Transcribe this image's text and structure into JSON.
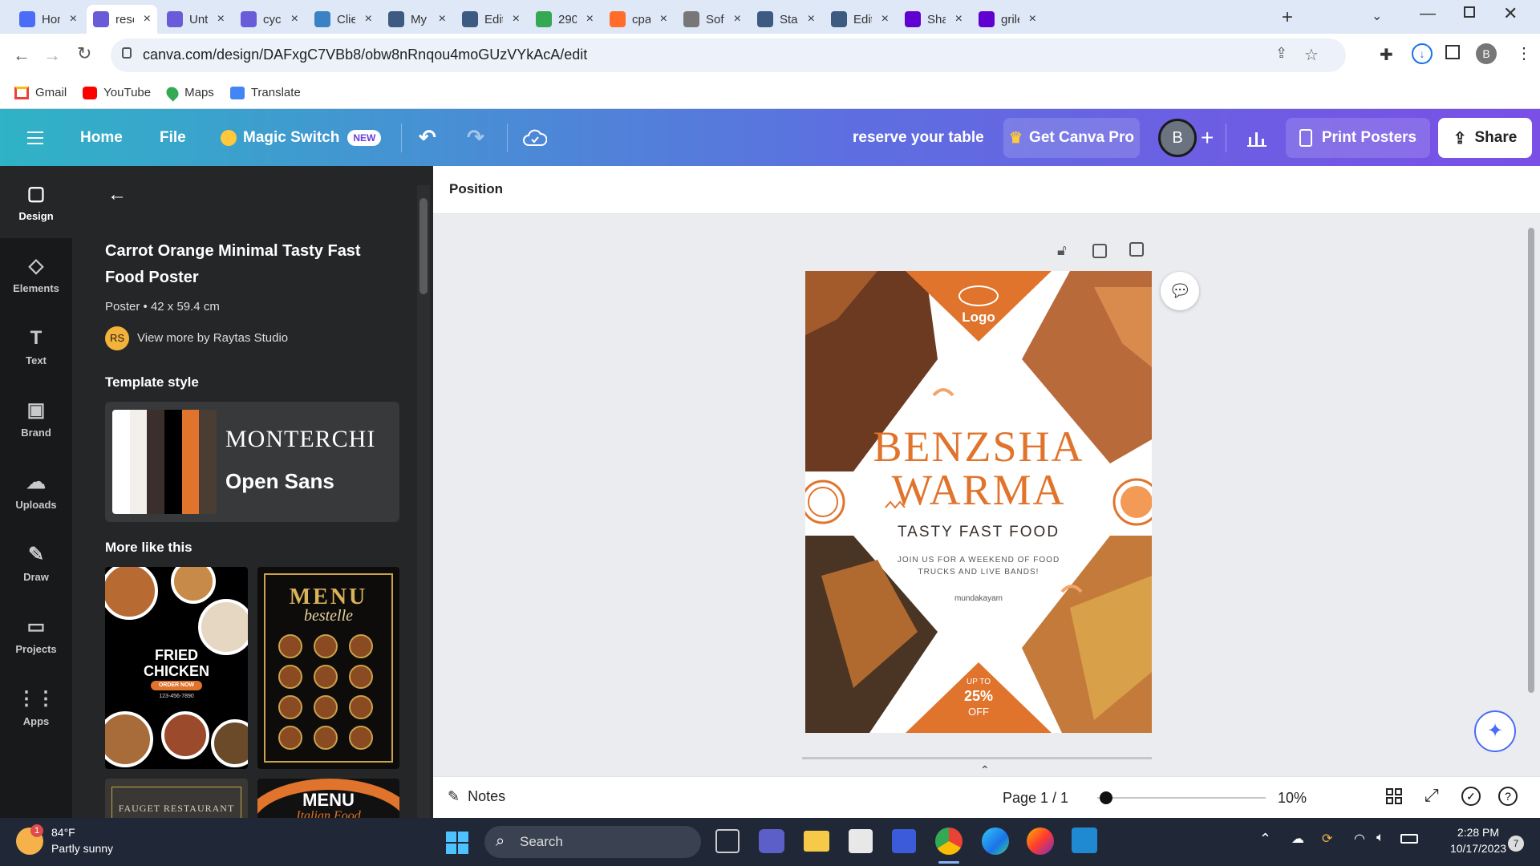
{
  "browser": {
    "tabs": [
      {
        "label": "Hon",
        "color": "#4a6cf7"
      },
      {
        "label": "rese",
        "color": "#6a5bd8"
      },
      {
        "label": "Unti",
        "color": "#6a5bd8"
      },
      {
        "label": "cycle",
        "color": "#6a5bd8"
      },
      {
        "label": "Clie",
        "color": "#3b82c4"
      },
      {
        "label": "My",
        "color": "#3d5a80"
      },
      {
        "label": "Edit",
        "color": "#3d5a80"
      },
      {
        "label": "290",
        "color": "#34a853"
      },
      {
        "label": "cpar",
        "color": "#ff6c2c"
      },
      {
        "label": "Soft",
        "color": "#777777"
      },
      {
        "label": "Star",
        "color": "#3d5a80"
      },
      {
        "label": "Edit",
        "color": "#3d5a80"
      },
      {
        "label": "Sha",
        "color": "#6001d2"
      },
      {
        "label": "grile",
        "color": "#6001d2"
      }
    ],
    "url": "canva.com/design/DAFxgC7VBb8/obw8nRnqou4moGUzVYkAcA/edit",
    "profile_initial": "B",
    "bookmarks": [
      "Gmail",
      "YouTube",
      "Maps",
      "Translate"
    ]
  },
  "canva_header": {
    "home": "Home",
    "file": "File",
    "magic_switch": "Magic Switch",
    "new_badge": "NEW",
    "design_title": "reserve your table",
    "get_pro": "Get Canva Pro",
    "avatar_initial": "B",
    "print": "Print Posters",
    "share": "Share"
  },
  "rail": [
    {
      "label": "Design",
      "icon": "design-icon"
    },
    {
      "label": "Elements",
      "icon": "elements-icon"
    },
    {
      "label": "Text",
      "icon": "text-icon"
    },
    {
      "label": "Brand",
      "icon": "brand-icon"
    },
    {
      "label": "Uploads",
      "icon": "uploads-icon"
    },
    {
      "label": "Draw",
      "icon": "draw-icon"
    },
    {
      "label": "Projects",
      "icon": "projects-icon"
    },
    {
      "label": "Apps",
      "icon": "apps-icon"
    }
  ],
  "panel": {
    "template_title": "Carrot Orange Minimal Tasty Fast Food Poster",
    "meta": "Poster • 42 x 59.4 cm",
    "author_initials": "RS",
    "author_link": "View more by Raytas Studio",
    "style_heading": "Template style",
    "font_heading_sample": "MONTERCHI",
    "font_body_sample": "Open Sans",
    "palette": [
      "#ffffff",
      "#f3f0ec",
      "#3a2f2a",
      "#000000",
      "#e0742c",
      "#4a3d34"
    ],
    "more_heading": "More like this",
    "thumb1": {
      "line1": "FRIED",
      "line2": "CHICKEN",
      "button": "ORDER NOW",
      "phone": "123-456-7890"
    },
    "thumb2": {
      "title": "MENU",
      "script": "bestelle"
    },
    "thumb3": {
      "title": "FAUGET RESTAURANT"
    },
    "thumb4": {
      "title": "MENU",
      "script": "Italian Food"
    }
  },
  "editor": {
    "position_label": "Position",
    "notes": "Notes",
    "page": "Page 1 / 1",
    "zoom": "10%",
    "zoom_level": 0.05
  },
  "poster": {
    "logo": "Logo",
    "title1": "BENZSHA",
    "title2": "WARMA",
    "subtitle": "TASTY FAST FOOD",
    "tagline1": "JOIN US FOR A WEEKEND OF FOOD",
    "tagline2": "TRUCKS AND LIVE BANDS!",
    "website": "mundakayam",
    "promo1": "UP TO",
    "promo2": "25%",
    "promo3": "OFF",
    "accent": "#e0742c"
  },
  "taskbar": {
    "weather_temp": "84°F",
    "weather_desc": "Partly sunny",
    "weather_badge": "1",
    "search": "Search",
    "time": "2:28 PM",
    "date": "10/17/2023",
    "notif_count": "7"
  }
}
